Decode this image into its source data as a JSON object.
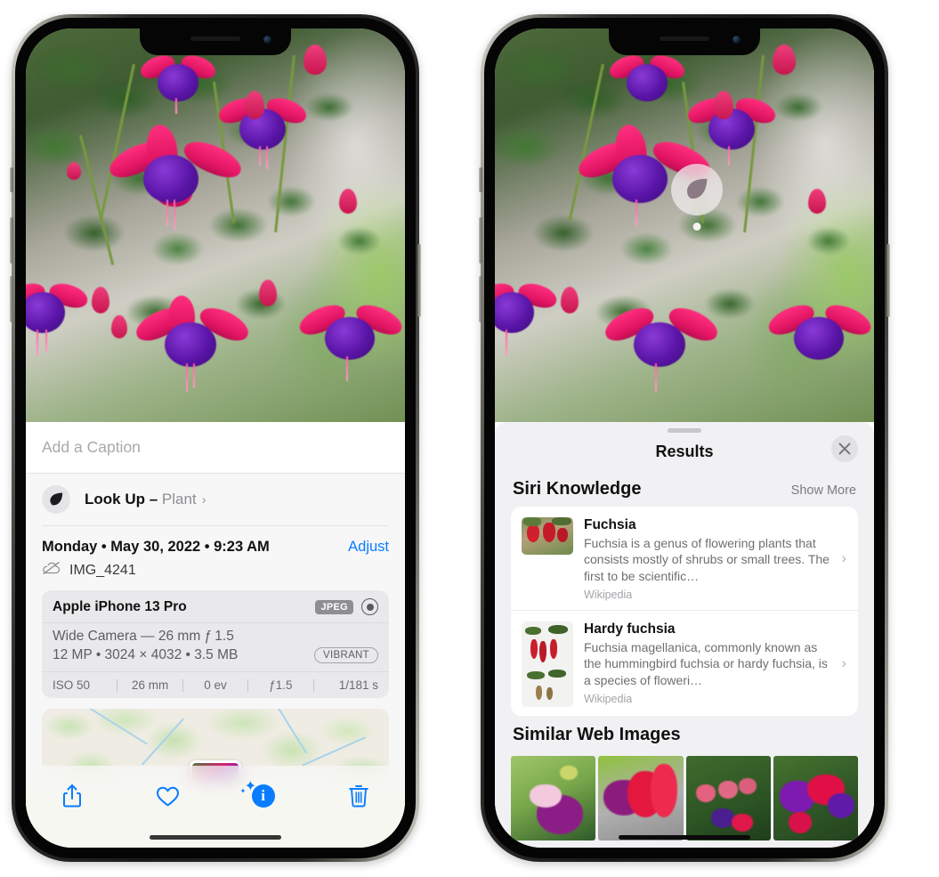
{
  "left_phone": {
    "caption": {
      "placeholder": "Add a Caption",
      "value": ""
    },
    "look_up": {
      "label": "Look Up – ",
      "subject": "Plant",
      "chevron": "›",
      "icon": "leaf-icon"
    },
    "meta": {
      "date": "Monday • May 30, 2022 • 9:23 AM",
      "adjust_label": "Adjust",
      "filename": "IMG_4241",
      "cloud_icon": "icloud-slash-icon"
    },
    "camera_card": {
      "device": "Apple iPhone 13 Pro",
      "format_tag": "JPEG",
      "aperture_icon": "aperture-icon",
      "lens_line": "Wide Camera — 26 mm ƒ 1.5",
      "specs_line": "12 MP • 3024 × 4032 • 3.5 MB",
      "style_tag": "VIBRANT",
      "exif": [
        "ISO 50",
        "26 mm",
        "0 ev",
        "ƒ1.5",
        "1/181 s"
      ]
    },
    "toolbar": [
      {
        "name": "share-button",
        "icon": "share-icon"
      },
      {
        "name": "favorite-button",
        "icon": "heart-icon"
      },
      {
        "name": "info-button",
        "icon": "info-sparkle-icon"
      },
      {
        "name": "delete-button",
        "icon": "trash-icon"
      }
    ],
    "colors": {
      "accent": "#0a7cff",
      "sheet_bg": "#f7f7f8",
      "card_bg": "#e9e9ec"
    }
  },
  "right_phone": {
    "visual_look_up_badge": {
      "icon": "leaf-icon"
    },
    "sheet": {
      "title": "Results",
      "close_icon": "close-icon",
      "sections": [
        {
          "title": "Siri Knowledge",
          "action": "Show More",
          "items": [
            {
              "title": "Fuchsia",
              "description": "Fuchsia is a genus of flowering plants that consists mostly of shrubs or small trees. The first to be scientific…",
              "source": "Wikipedia",
              "chevron": "›"
            },
            {
              "title": "Hardy fuchsia",
              "description": "Fuchsia magellanica, commonly known as the hummingbird fuchsia or hardy fuchsia, is a species of floweri…",
              "source": "Wikipedia",
              "chevron": "›"
            }
          ]
        },
        {
          "title": "Similar Web Images",
          "items": [
            {
              "name": "similar-image-1"
            },
            {
              "name": "similar-image-2"
            },
            {
              "name": "similar-image-3"
            },
            {
              "name": "similar-image-4"
            }
          ]
        }
      ]
    },
    "colors": {
      "sheet_bg": "#f1f1f4",
      "card_bg": "#ffffff"
    }
  }
}
